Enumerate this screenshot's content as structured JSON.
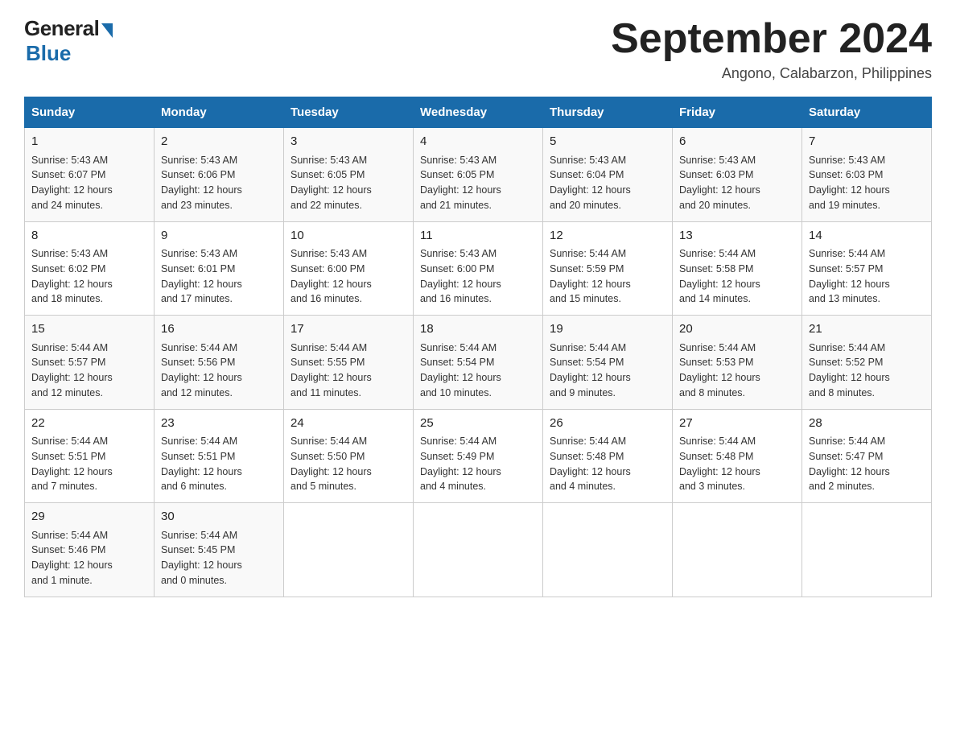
{
  "header": {
    "logo_general": "General",
    "logo_blue": "Blue",
    "title": "September 2024",
    "location": "Angono, Calabarzon, Philippines"
  },
  "days_of_week": [
    "Sunday",
    "Monday",
    "Tuesday",
    "Wednesday",
    "Thursday",
    "Friday",
    "Saturday"
  ],
  "weeks": [
    [
      {
        "num": "1",
        "sunrise": "5:43 AM",
        "sunset": "6:07 PM",
        "daylight": "12 hours and 24 minutes."
      },
      {
        "num": "2",
        "sunrise": "5:43 AM",
        "sunset": "6:06 PM",
        "daylight": "12 hours and 23 minutes."
      },
      {
        "num": "3",
        "sunrise": "5:43 AM",
        "sunset": "6:05 PM",
        "daylight": "12 hours and 22 minutes."
      },
      {
        "num": "4",
        "sunrise": "5:43 AM",
        "sunset": "6:05 PM",
        "daylight": "12 hours and 21 minutes."
      },
      {
        "num": "5",
        "sunrise": "5:43 AM",
        "sunset": "6:04 PM",
        "daylight": "12 hours and 20 minutes."
      },
      {
        "num": "6",
        "sunrise": "5:43 AM",
        "sunset": "6:03 PM",
        "daylight": "12 hours and 20 minutes."
      },
      {
        "num": "7",
        "sunrise": "5:43 AM",
        "sunset": "6:03 PM",
        "daylight": "12 hours and 19 minutes."
      }
    ],
    [
      {
        "num": "8",
        "sunrise": "5:43 AM",
        "sunset": "6:02 PM",
        "daylight": "12 hours and 18 minutes."
      },
      {
        "num": "9",
        "sunrise": "5:43 AM",
        "sunset": "6:01 PM",
        "daylight": "12 hours and 17 minutes."
      },
      {
        "num": "10",
        "sunrise": "5:43 AM",
        "sunset": "6:00 PM",
        "daylight": "12 hours and 16 minutes."
      },
      {
        "num": "11",
        "sunrise": "5:43 AM",
        "sunset": "6:00 PM",
        "daylight": "12 hours and 16 minutes."
      },
      {
        "num": "12",
        "sunrise": "5:44 AM",
        "sunset": "5:59 PM",
        "daylight": "12 hours and 15 minutes."
      },
      {
        "num": "13",
        "sunrise": "5:44 AM",
        "sunset": "5:58 PM",
        "daylight": "12 hours and 14 minutes."
      },
      {
        "num": "14",
        "sunrise": "5:44 AM",
        "sunset": "5:57 PM",
        "daylight": "12 hours and 13 minutes."
      }
    ],
    [
      {
        "num": "15",
        "sunrise": "5:44 AM",
        "sunset": "5:57 PM",
        "daylight": "12 hours and 12 minutes."
      },
      {
        "num": "16",
        "sunrise": "5:44 AM",
        "sunset": "5:56 PM",
        "daylight": "12 hours and 12 minutes."
      },
      {
        "num": "17",
        "sunrise": "5:44 AM",
        "sunset": "5:55 PM",
        "daylight": "12 hours and 11 minutes."
      },
      {
        "num": "18",
        "sunrise": "5:44 AM",
        "sunset": "5:54 PM",
        "daylight": "12 hours and 10 minutes."
      },
      {
        "num": "19",
        "sunrise": "5:44 AM",
        "sunset": "5:54 PM",
        "daylight": "12 hours and 9 minutes."
      },
      {
        "num": "20",
        "sunrise": "5:44 AM",
        "sunset": "5:53 PM",
        "daylight": "12 hours and 8 minutes."
      },
      {
        "num": "21",
        "sunrise": "5:44 AM",
        "sunset": "5:52 PM",
        "daylight": "12 hours and 8 minutes."
      }
    ],
    [
      {
        "num": "22",
        "sunrise": "5:44 AM",
        "sunset": "5:51 PM",
        "daylight": "12 hours and 7 minutes."
      },
      {
        "num": "23",
        "sunrise": "5:44 AM",
        "sunset": "5:51 PM",
        "daylight": "12 hours and 6 minutes."
      },
      {
        "num": "24",
        "sunrise": "5:44 AM",
        "sunset": "5:50 PM",
        "daylight": "12 hours and 5 minutes."
      },
      {
        "num": "25",
        "sunrise": "5:44 AM",
        "sunset": "5:49 PM",
        "daylight": "12 hours and 4 minutes."
      },
      {
        "num": "26",
        "sunrise": "5:44 AM",
        "sunset": "5:48 PM",
        "daylight": "12 hours and 4 minutes."
      },
      {
        "num": "27",
        "sunrise": "5:44 AM",
        "sunset": "5:48 PM",
        "daylight": "12 hours and 3 minutes."
      },
      {
        "num": "28",
        "sunrise": "5:44 AM",
        "sunset": "5:47 PM",
        "daylight": "12 hours and 2 minutes."
      }
    ],
    [
      {
        "num": "29",
        "sunrise": "5:44 AM",
        "sunset": "5:46 PM",
        "daylight": "12 hours and 1 minute."
      },
      {
        "num": "30",
        "sunrise": "5:44 AM",
        "sunset": "5:45 PM",
        "daylight": "12 hours and 0 minutes."
      },
      null,
      null,
      null,
      null,
      null
    ]
  ],
  "labels": {
    "sunrise": "Sunrise:",
    "sunset": "Sunset:",
    "daylight": "Daylight:"
  }
}
